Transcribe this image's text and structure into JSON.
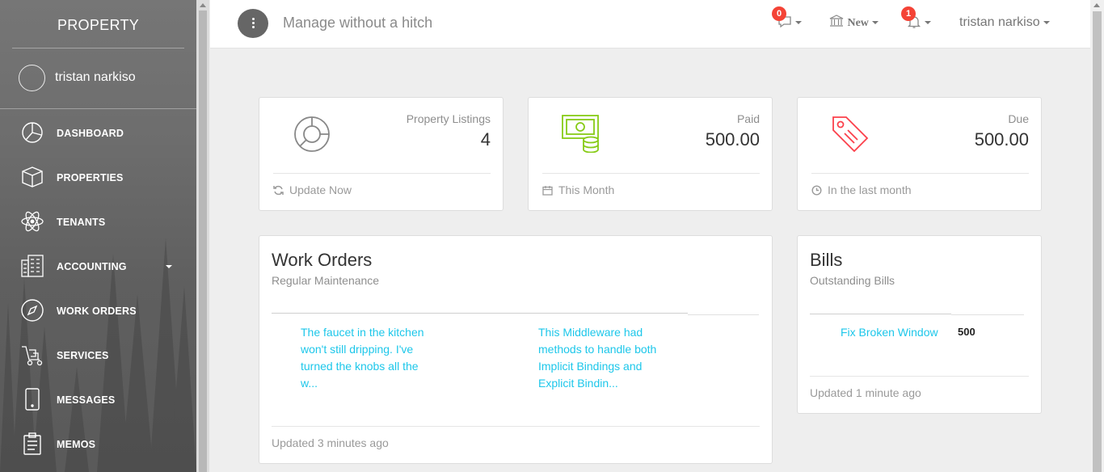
{
  "sidebar": {
    "brand": "PROPERTY",
    "user_name": "tristan narkiso",
    "items": [
      {
        "label": "DASHBOARD",
        "icon": "dashboard-icon"
      },
      {
        "label": "PROPERTIES",
        "icon": "box-icon"
      },
      {
        "label": "TENANTS",
        "icon": "atom-icon"
      },
      {
        "label": "ACCOUNTING",
        "icon": "building-icon",
        "has_caret": true
      },
      {
        "label": "WORK ORDERS",
        "icon": "compass-icon"
      },
      {
        "label": "SERVICES",
        "icon": "delivery-icon"
      },
      {
        "label": "MESSAGES",
        "icon": "phone-icon"
      },
      {
        "label": "MEMOS",
        "icon": "clipboard-icon"
      }
    ]
  },
  "header": {
    "tagline": "Manage without a hitch",
    "messages_count": "0",
    "new_label": "New",
    "notifications_count": "1",
    "user_name": "tristan narkiso"
  },
  "stats": [
    {
      "category": "Property Listings",
      "value": "4",
      "footer": "Update Now",
      "icon": "chart-pie-icon",
      "footer_icon": "refresh-icon",
      "color": "#888888"
    },
    {
      "category": "Paid",
      "value": "500.00",
      "footer": "This Month",
      "icon": "money-icon",
      "footer_icon": "calendar-icon",
      "color": "#87cb16"
    },
    {
      "category": "Due",
      "value": "500.00",
      "footer": "In the last month",
      "icon": "price-tag-icon",
      "footer_icon": "clock-icon",
      "color": "#fb404b"
    }
  ],
  "work_orders": {
    "title": "Work Orders",
    "subtitle": "Regular Maintenance",
    "items": [
      "The faucet in the kitchen won't still dripping. I've turned the knobs all the w...",
      "This Middleware had methods to handle both Implicit Bindings and Explicit Bindin..."
    ],
    "updated": "Updated 3 minutes ago"
  },
  "bills": {
    "title": "Bills",
    "subtitle": "Outstanding Bills",
    "items": [
      {
        "name": "Fix Broken Window",
        "amount": "500"
      }
    ],
    "updated": "Updated 1 minute ago"
  },
  "colors": {
    "accent_link": "#1dc7ea",
    "badge": "#f44336",
    "success": "#87cb16",
    "danger": "#fb404b"
  }
}
